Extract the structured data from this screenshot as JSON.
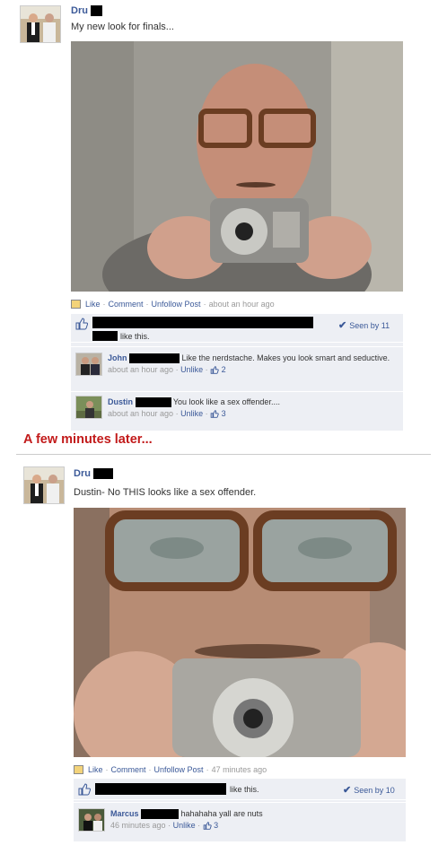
{
  "post1": {
    "author": "Dru",
    "status": "My new look for finals...",
    "actions": {
      "like": "Like",
      "comment": "Comment",
      "unfollow": "Unfollow Post",
      "time": "about an hour ago"
    },
    "likes_text": "like this.",
    "seen": "Seen by 11",
    "comments": [
      {
        "name": "John",
        "text": "Like the nerdstache. Makes you look smart and seductive.",
        "time": "about an hour ago",
        "unlike": "Unlike",
        "likes": "2"
      },
      {
        "name": "Dustin",
        "text": "You look like a sex offender....",
        "time": "about an hour ago",
        "unlike": "Unlike",
        "likes": "3"
      }
    ]
  },
  "headline": "A few minutes later...",
  "post2": {
    "author": "Dru",
    "status": "Dustin- No THIS looks like a sex offender.",
    "actions": {
      "like": "Like",
      "comment": "Comment",
      "unfollow": "Unfollow Post",
      "time": "47 minutes ago"
    },
    "likes_text": "like this.",
    "seen": "Seen by 10",
    "comments": [
      {
        "name": "Marcus",
        "text": "hahahaha yall are nuts",
        "time": "46 minutes ago",
        "unlike": "Unlike",
        "likes": "3"
      }
    ]
  },
  "separators": {
    "dot": "·"
  },
  "icons": {
    "thumb": "thumbs-up-icon",
    "check": "checkmark-icon",
    "app": "mobile-upload-icon"
  },
  "colors": {
    "link": "#3b5998",
    "headline": "#c21a1a",
    "box": "#edeff4"
  }
}
